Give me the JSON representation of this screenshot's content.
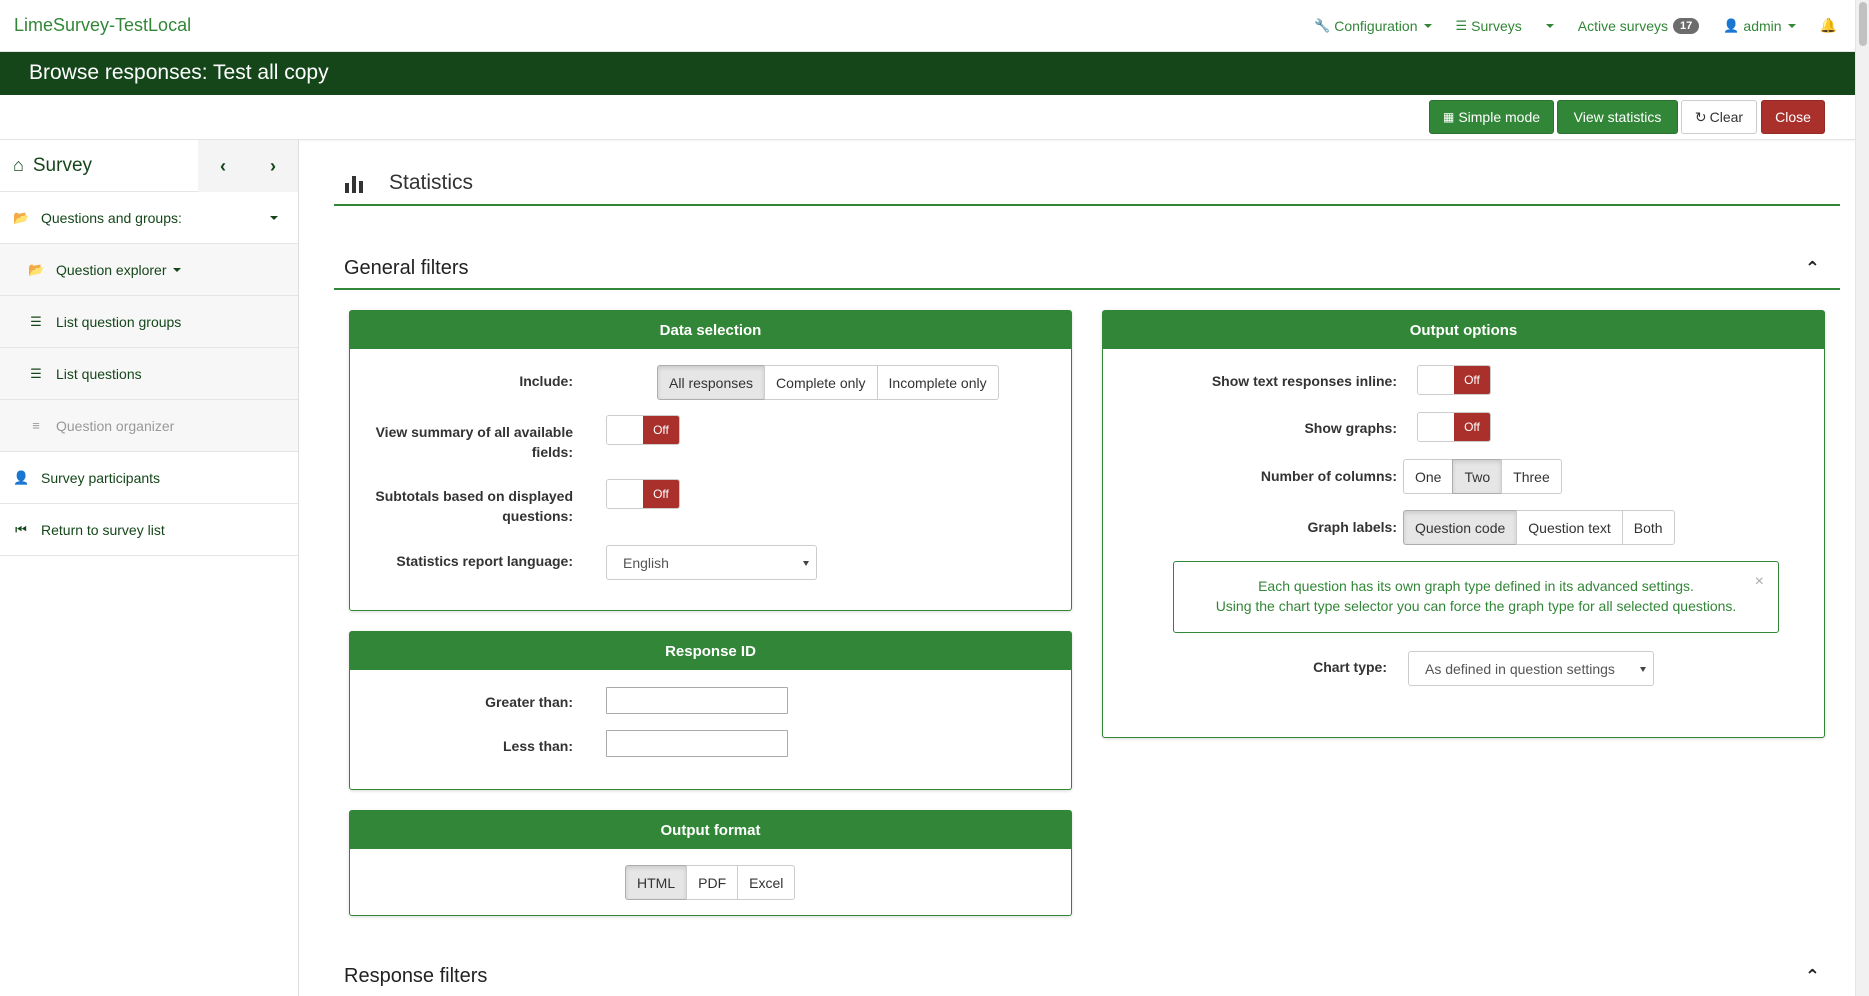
{
  "topnav": {
    "brand": "LimeSurvey-TestLocal",
    "configuration": "Configuration",
    "surveys": "Surveys",
    "active_surveys": "Active surveys",
    "active_count": "17",
    "user": "admin"
  },
  "titlebar": {
    "title": "Browse responses: Test all copy"
  },
  "toolbar": {
    "simple_mode": "Simple mode",
    "view_statistics": "View statistics",
    "clear": "Clear",
    "close": "Close"
  },
  "sidebar": {
    "title": "Survey",
    "items": [
      {
        "label": "Questions and groups:"
      },
      {
        "label": "Question explorer"
      },
      {
        "label": "List question groups"
      },
      {
        "label": "List questions"
      },
      {
        "label": "Question organizer"
      },
      {
        "label": "Survey participants"
      },
      {
        "label": "Return to survey list"
      }
    ]
  },
  "main": {
    "heading": "Statistics",
    "general_filters": "General filters",
    "response_filters": "Response filters",
    "data_selection": {
      "title": "Data selection",
      "include_label": "Include:",
      "include_options": [
        "All responses",
        "Complete only",
        "Incomplete only"
      ],
      "summary_label": "View summary of all available fields:",
      "subtotals_label": "Subtotals based on displayed questions:",
      "toggle_off": "Off",
      "language_label": "Statistics report language:",
      "language_value": "English"
    },
    "response_id": {
      "title": "Response ID",
      "greater_label": "Greater than:",
      "less_label": "Less than:"
    },
    "output_format": {
      "title": "Output format",
      "options": [
        "HTML",
        "PDF",
        "Excel"
      ]
    },
    "output_options": {
      "title": "Output options",
      "text_inline_label": "Show text responses inline:",
      "graphs_label": "Show graphs:",
      "toggle_off": "Off",
      "columns_label": "Number of columns:",
      "columns_options": [
        "One",
        "Two",
        "Three"
      ],
      "graph_labels_label": "Graph labels:",
      "graph_labels_options": [
        "Question code",
        "Question text",
        "Both"
      ],
      "alert_line1": "Each question has its own graph type defined in its advanced settings.",
      "alert_line2": "Using the chart type selector you can force the graph type for all selected questions.",
      "chart_type_label": "Chart type:",
      "chart_type_value": "As defined in question settings"
    }
  }
}
